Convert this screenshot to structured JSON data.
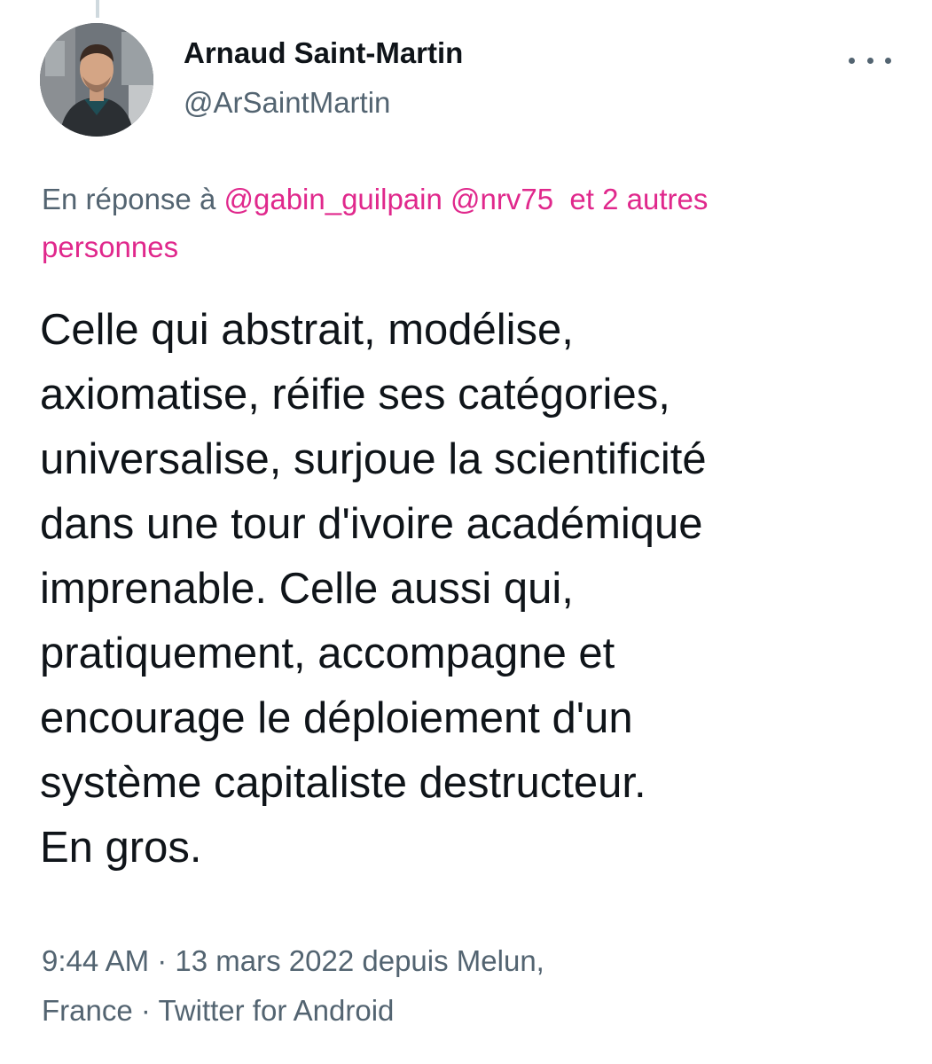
{
  "author": {
    "display_name": "Arnaud Saint-Martin",
    "handle": "@ArSaintMartin",
    "avatar_icon": "user-photo"
  },
  "reply": {
    "prefix": "En réponse à",
    "mentions": [
      "@gabin_guilpain",
      "@nrv75"
    ],
    "others_line1": "et 2 autres",
    "others_line2": "personnes"
  },
  "tweet": {
    "lines": [
      "Celle qui abstrait, modélise,",
      "axiomatise, réifie ses catégories,",
      "universalise, surjoue la scientificité",
      "dans une tour d'ivoire académique",
      "imprenable. Celle aussi qui,",
      "pratiquement, accompagne et",
      "encourage le déploiement d'un",
      "système capitaliste destructeur.",
      "En gros."
    ]
  },
  "meta": {
    "time": "9:44 AM",
    "separator": " · ",
    "date": "13 mars 2022",
    "location_prefix": "depuis",
    "location_line1": "Melun,",
    "location_line2": "France",
    "source": "Twitter for Android"
  },
  "colors": {
    "accent": "#e0288c",
    "text": "#0f1419",
    "secondary": "#536471"
  },
  "icons": {
    "more": "more-horizontal-icon"
  }
}
